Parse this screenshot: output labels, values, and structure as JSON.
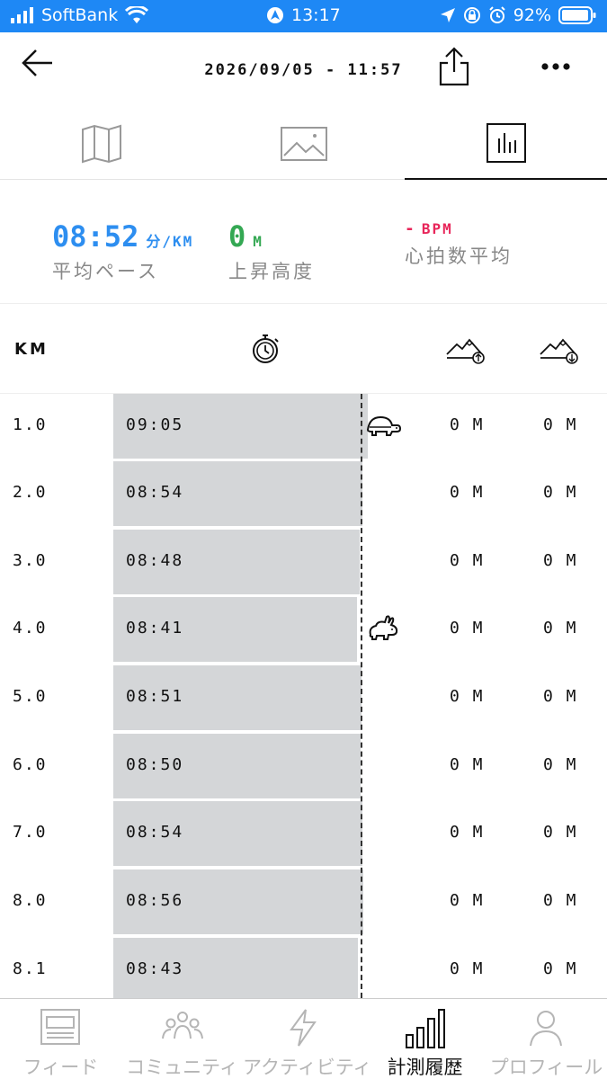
{
  "status_bar": {
    "carrier": "SoftBank",
    "time": "13:17",
    "battery": "92%"
  },
  "header": {
    "title": "2026/09/05 - 11:57"
  },
  "tabs": [
    {
      "name": "map-icon",
      "active": false
    },
    {
      "name": "image-icon",
      "active": false
    },
    {
      "name": "chart-icon",
      "active": true
    }
  ],
  "summary": {
    "pace": {
      "value": "08:52",
      "unit": "分/KM",
      "label": "平均ペース",
      "color": "#2d8ef0"
    },
    "elevation": {
      "value": "0",
      "unit": "M",
      "label": "上昇高度",
      "color": "#34a853"
    },
    "heart_rate": {
      "value": "-",
      "unit": "BPM",
      "label": "心拍数平均",
      "color": "#e8265a"
    }
  },
  "table": {
    "km_header": "KM",
    "columns": [
      "stopwatch-icon",
      "elevation-up-icon",
      "elevation-down-icon"
    ],
    "rows": [
      {
        "km": "1.0",
        "pace": "09:05",
        "pace_seconds": 545,
        "up": "0 M",
        "down": "0 M",
        "marker": "slowest"
      },
      {
        "km": "2.0",
        "pace": "08:54",
        "pace_seconds": 534,
        "up": "0 M",
        "down": "0 M",
        "marker": ""
      },
      {
        "km": "3.0",
        "pace": "08:48",
        "pace_seconds": 528,
        "up": "0 M",
        "down": "0 M",
        "marker": ""
      },
      {
        "km": "4.0",
        "pace": "08:41",
        "pace_seconds": 521,
        "up": "0 M",
        "down": "0 M",
        "marker": "fastest"
      },
      {
        "km": "5.0",
        "pace": "08:51",
        "pace_seconds": 531,
        "up": "0 M",
        "down": "0 M",
        "marker": ""
      },
      {
        "km": "6.0",
        "pace": "08:50",
        "pace_seconds": 530,
        "up": "0 M",
        "down": "0 M",
        "marker": ""
      },
      {
        "km": "7.0",
        "pace": "08:54",
        "pace_seconds": 534,
        "up": "0 M",
        "down": "0 M",
        "marker": ""
      },
      {
        "km": "8.0",
        "pace": "08:56",
        "pace_seconds": 536,
        "up": "0 M",
        "down": "0 M",
        "marker": ""
      },
      {
        "km": "8.1",
        "pace": "08:43",
        "pace_seconds": 523,
        "up": "0 M",
        "down": "0 M",
        "marker": ""
      }
    ]
  },
  "nav": {
    "items": [
      {
        "label": "フィード",
        "icon": "feed-icon",
        "active": false
      },
      {
        "label": "コミュニティ",
        "icon": "community-icon",
        "active": false
      },
      {
        "label": "アクティビティ",
        "icon": "activity-icon",
        "active": false
      },
      {
        "label": "計測履歴",
        "icon": "history-icon",
        "active": true
      },
      {
        "label": "プロフィール",
        "icon": "profile-icon",
        "active": false
      }
    ]
  }
}
